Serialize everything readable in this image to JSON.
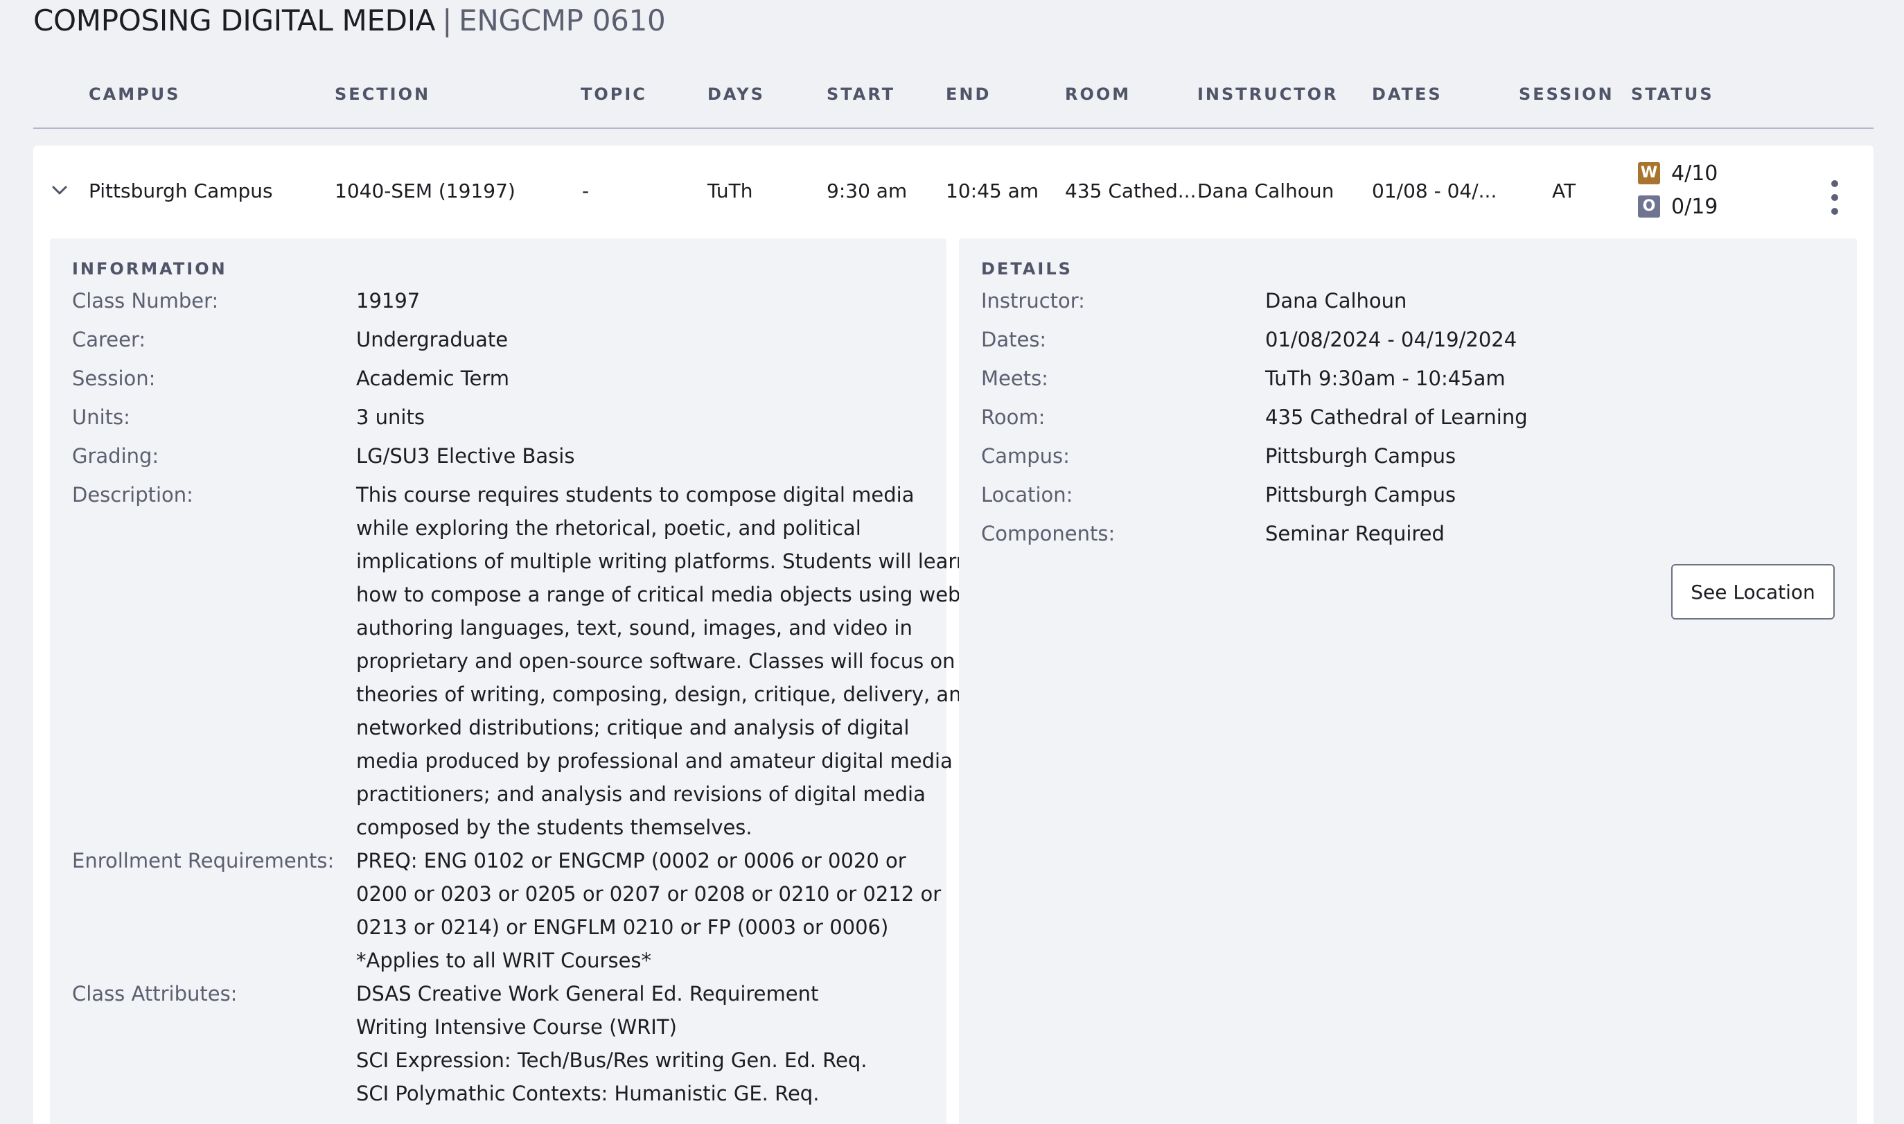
{
  "course": {
    "name": "COMPOSING DIGITAL MEDIA",
    "separator": "|",
    "code": "ENGCMP 0610"
  },
  "columns": {
    "campus": "CAMPUS",
    "section": "SECTION",
    "topic": "TOPIC",
    "days": "DAYS",
    "start": "START",
    "end": "END",
    "room": "ROOM",
    "instructor": "INSTRUCTOR",
    "dates": "DATES",
    "session": "SESSION",
    "status": "STATUS"
  },
  "section_row": {
    "campus": "Pittsburgh Campus",
    "section": "1040-SEM (19197)",
    "topic": "-",
    "days": "TuTh",
    "start": "9:30 am",
    "end": "10:45 am",
    "room": "435 Cathed...",
    "instructor": "Dana Calhoun",
    "dates": "01/08 - 04/...",
    "session": "AT",
    "status": {
      "waitlist_badge": "W",
      "waitlist_value": "4/10",
      "waitlist_color": "#a8742e",
      "open_badge": "O",
      "open_value": "0/19",
      "open_color": "#6f7490"
    }
  },
  "information": {
    "title": "INFORMATION",
    "class_number_label": "Class Number:",
    "class_number": "19197",
    "career_label": "Career:",
    "career": "Undergraduate",
    "session_label": "Session:",
    "session": "Academic Term",
    "units_label": "Units:",
    "units": "3 units",
    "grading_label": "Grading:",
    "grading": "LG/SU3 Elective Basis",
    "description_label": "Description:",
    "description_lines": [
      "This course requires students to compose digital media",
      "while exploring the rhetorical, poetic, and political",
      "implications of multiple writing platforms. Students will learn",
      "how to compose a range of critical media objects using web-",
      "authoring languages, text, sound, images, and video in",
      "proprietary and open-source software. Classes will focus on",
      "theories of writing, composing, design, critique, delivery, and",
      "networked distributions; critique and analysis of digital",
      "media produced by professional and amateur digital media",
      "practitioners; and analysis and revisions of digital media",
      "composed by the students themselves."
    ],
    "enrollment_label": "Enrollment Requirements:",
    "enrollment_lines": [
      "PREQ: ENG 0102 or ENGCMP (0002 or 0006 or 0020 or",
      "0200 or 0203 or 0205 or 0207 or 0208 or 0210 or 0212 or",
      "0213 or 0214) or ENGFLM 0210 or FP (0003 or 0006)",
      "*Applies to all WRIT Courses*"
    ],
    "attributes_label": "Class Attributes:",
    "attributes": [
      "DSAS Creative Work General Ed. Requirement",
      "Writing Intensive Course (WRIT)",
      "SCI Expression: Tech/Bus/Res writing Gen. Ed. Req.",
      "SCI Polymathic Contexts: Humanistic GE. Req."
    ]
  },
  "details": {
    "title": "DETAILS",
    "instructor_label": "Instructor:",
    "instructor": "Dana Calhoun",
    "dates_label": "Dates:",
    "dates": "01/08/2024 - 04/19/2024",
    "meets_label": "Meets:",
    "meets": "TuTh 9:30am - 10:45am",
    "room_label": "Room:",
    "room": "435 Cathedral of Learning",
    "campus_label": "Campus:",
    "campus": "Pittsburgh Campus",
    "location_label": "Location:",
    "location": "Pittsburgh Campus",
    "components_label": "Components:",
    "components": "Seminar Required",
    "see_location_button": "See Location"
  },
  "icons": {
    "expand": "chevron-down-icon",
    "menu": "more-vertical-icon"
  }
}
